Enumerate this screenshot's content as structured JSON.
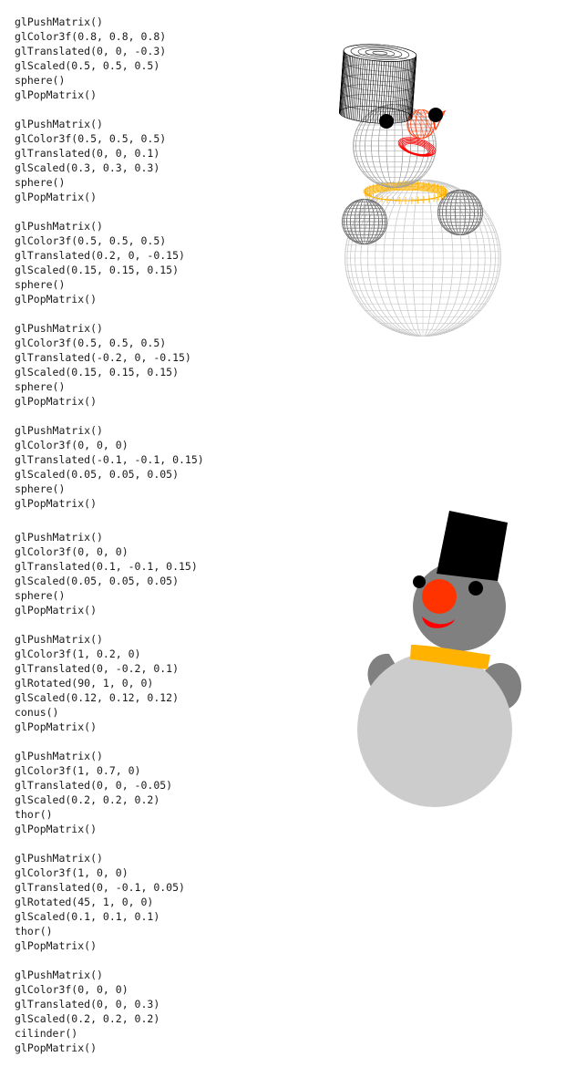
{
  "code_blocks": [
    [
      "glPushMatrix()",
      "glColor3f(0.8, 0.8, 0.8)",
      "glTranslated(0, 0, -0.3)",
      "glScaled(0.5, 0.5, 0.5)",
      "sphere()",
      "glPopMatrix()"
    ],
    [
      "glPushMatrix()",
      "glColor3f(0.5, 0.5, 0.5)",
      "glTranslated(0, 0, 0.1)",
      "glScaled(0.3, 0.3, 0.3)",
      "sphere()",
      "glPopMatrix()"
    ],
    [
      "glPushMatrix()",
      "glColor3f(0.5, 0.5, 0.5)",
      "glTranslated(0.2, 0, -0.15)",
      "glScaled(0.15, 0.15, 0.15)",
      "sphere()",
      "glPopMatrix()"
    ],
    [
      "glPushMatrix()",
      "glColor3f(0.5, 0.5, 0.5)",
      "glTranslated(-0.2, 0, -0.15)",
      "glScaled(0.15, 0.15, 0.15)",
      "sphere()",
      "glPopMatrix()"
    ],
    [
      "glPushMatrix()",
      "glColor3f(0, 0, 0)",
      "glTranslated(-0.1, -0.1, 0.15)",
      "glScaled(0.05, 0.05, 0.05)",
      "sphere()",
      "glPopMatrix()"
    ],
    [
      "glPushMatrix()",
      "glColor3f(0, 0, 0)",
      "glTranslated(0.1, -0.1, 0.15)",
      "glScaled(0.05, 0.05, 0.05)",
      "sphere()",
      "glPopMatrix()"
    ],
    [
      "glPushMatrix()",
      "glColor3f(1, 0.2, 0)",
      "glTranslated(0, -0.2, 0.1)",
      "glRotated(90, 1, 0, 0)",
      "glScaled(0.12, 0.12, 0.12)",
      "conus()",
      "glPopMatrix()"
    ],
    [
      "glPushMatrix()",
      "glColor3f(1, 0.7, 0)",
      "glTranslated(0, 0, -0.05)",
      "glScaled(0.2, 0.2, 0.2)",
      "thor()",
      "glPopMatrix()"
    ],
    [
      "glPushMatrix()",
      "glColor3f(1, 0, 0)",
      "glTranslated(0, -0.1, 0.05)",
      "glRotated(45, 1, 0, 0)",
      "glScaled(0.1, 0.1, 0.1)",
      "thor()",
      "glPopMatrix()"
    ],
    [
      "glPushMatrix()",
      "glColor3f(0, 0, 0)",
      "glTranslated(0, 0, 0.3)",
      "glScaled(0.2, 0.2, 0.2)",
      "cilinder()",
      "glPopMatrix()"
    ]
  ],
  "colors": {
    "body": "#cccccc",
    "head": "#808080",
    "arms": "#808080",
    "eyes": "#000000",
    "nose": "#ff3300",
    "scarf": "#ffb300",
    "mouth": "#ff0000",
    "hat": "#000000"
  },
  "illustrations": [
    "wireframe-snowman",
    "solid-snowman"
  ]
}
